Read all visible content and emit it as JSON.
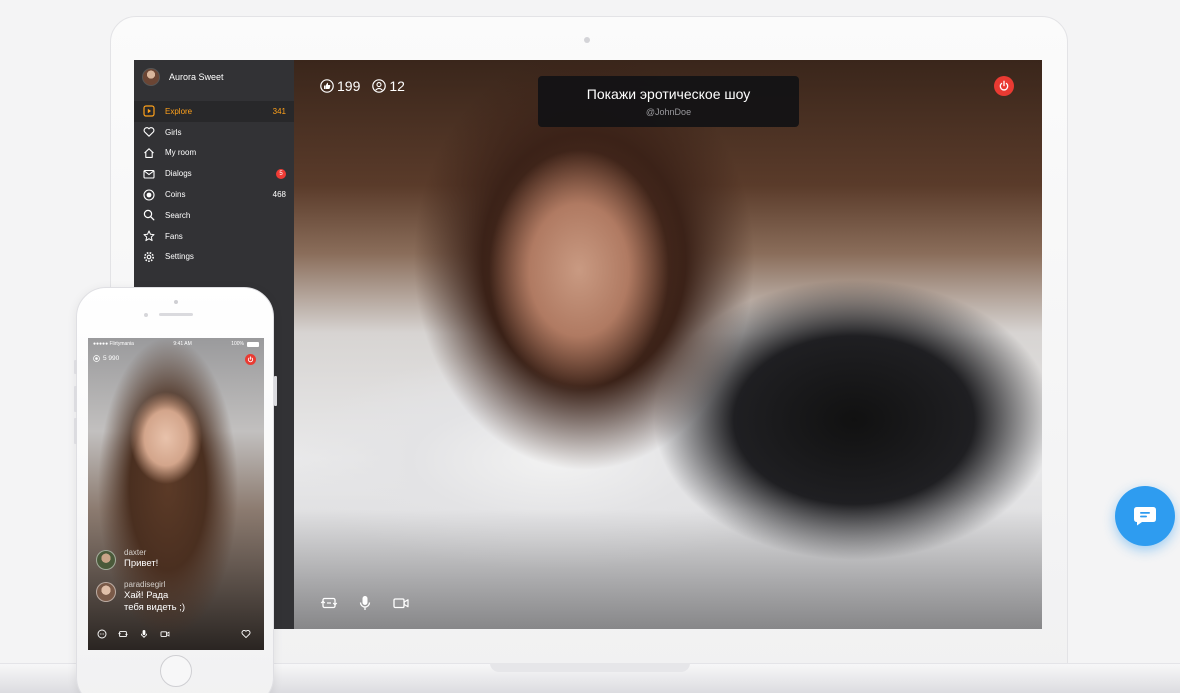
{
  "laptop": {
    "sidebar": {
      "profile_name": "Aurora Sweet",
      "items": [
        {
          "label": "Explore",
          "icon": "play-icon",
          "count": "341",
          "active": true
        },
        {
          "label": "Girls",
          "icon": "heart-icon"
        },
        {
          "label": "My room",
          "icon": "home-icon"
        },
        {
          "label": "Dialogs",
          "icon": "mail-icon",
          "badge": "5"
        },
        {
          "label": "Coins",
          "icon": "coin-icon",
          "count": "468"
        },
        {
          "label": "Search",
          "icon": "search-icon"
        },
        {
          "label": "Fans",
          "icon": "star-icon"
        },
        {
          "label": "Settings",
          "icon": "gear-icon"
        }
      ]
    },
    "video": {
      "likes": "199",
      "viewers": "12",
      "message_text": "Покажи эротическое шоу",
      "message_user": "@JohnDoe"
    }
  },
  "phone": {
    "status_carrier": "●●●●● Flirtymania",
    "status_time": "9:41 AM",
    "status_battery": "100%",
    "coins": "5 990",
    "chat": [
      {
        "user": "daxter",
        "text": "Привет!"
      },
      {
        "user": "paradisegirl",
        "text_line1": "Хай! Рада",
        "text_line2": "тебя видеть ;)"
      }
    ]
  },
  "colors": {
    "accent": "#ffa11b",
    "sidebar_bg": "#323235",
    "badge_red": "#ef3b35",
    "power_red": "#ea3a32",
    "chat_widget_blue": "#2e9cf0"
  }
}
